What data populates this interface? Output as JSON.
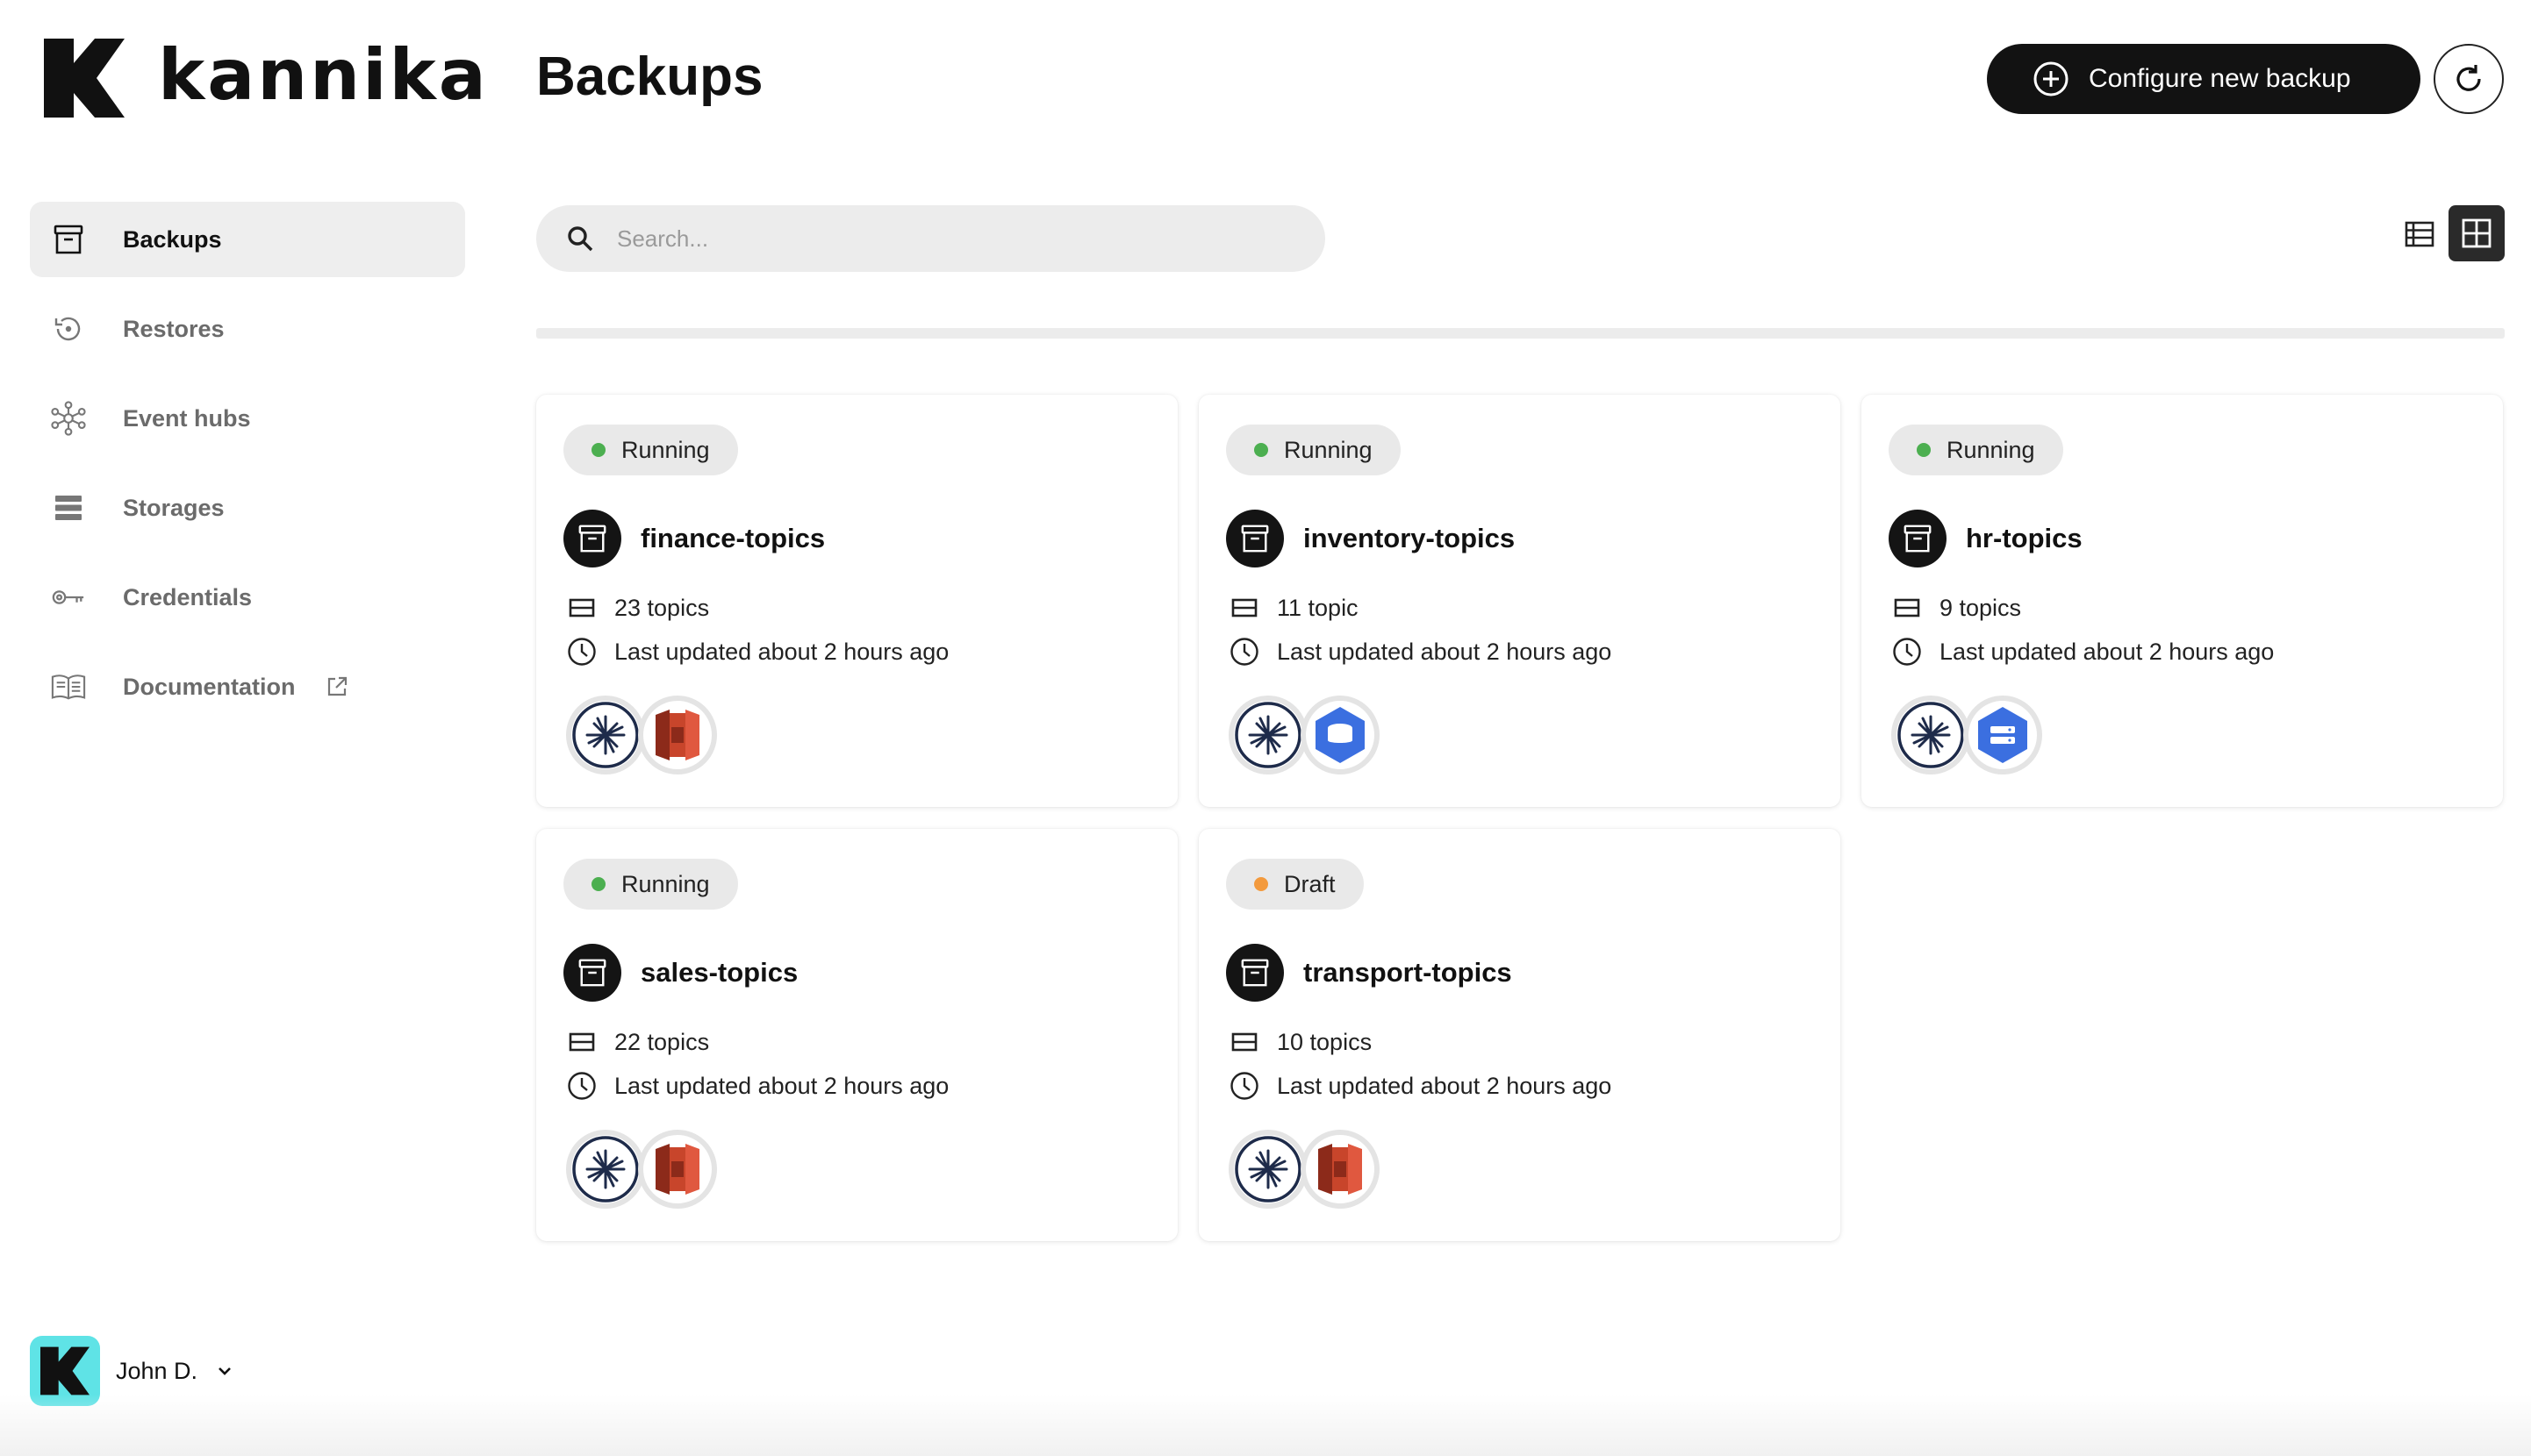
{
  "brand": {
    "name": "kannika"
  },
  "sidebar": {
    "items": [
      {
        "label": "Backups",
        "icon": "archive-box-icon",
        "active": true
      },
      {
        "label": "Restores",
        "icon": "restore-icon",
        "active": false
      },
      {
        "label": "Event hubs",
        "icon": "hub-network-icon",
        "active": false
      },
      {
        "label": "Storages",
        "icon": "storage-stack-icon",
        "active": false
      },
      {
        "label": "Credentials",
        "icon": "key-icon",
        "active": false
      },
      {
        "label": "Documentation",
        "icon": "book-icon",
        "active": false,
        "external": true
      }
    ]
  },
  "user": {
    "name": "John D.",
    "avatar_color": "#5fe3e6"
  },
  "header": {
    "title": "Backups",
    "configure_label": "Configure new backup"
  },
  "search": {
    "placeholder": "Search..."
  },
  "colors": {
    "running": "#4caf50",
    "draft": "#f39a3d",
    "primary_button": "#121212",
    "s3_red": "#c8452b",
    "gcp_blue": "#3b6fe0"
  },
  "cards": [
    {
      "status": "Running",
      "name": "finance-topics",
      "topics": "23 topics",
      "updated": "Last updated about 2 hours ago",
      "source": "kafka-icon",
      "storage": "aws-s3-icon"
    },
    {
      "status": "Running",
      "name": "inventory-topics",
      "topics": "11 topic",
      "updated": "Last updated about 2 hours ago",
      "source": "kafka-icon",
      "storage": "gcp-storage-icon"
    },
    {
      "status": "Running",
      "name": "hr-topics",
      "topics": "9 topics",
      "updated": "Last updated about 2 hours ago",
      "source": "kafka-icon",
      "storage": "gcp-filestore-icon"
    },
    {
      "status": "Running",
      "name": "sales-topics",
      "topics": "22 topics",
      "updated": "Last updated about 2 hours ago",
      "source": "kafka-icon",
      "storage": "aws-s3-icon"
    },
    {
      "status": "Draft",
      "name": "transport-topics",
      "topics": "10 topics",
      "updated": "Last updated about 2 hours ago",
      "source": "kafka-icon",
      "storage": "aws-s3-icon"
    }
  ]
}
